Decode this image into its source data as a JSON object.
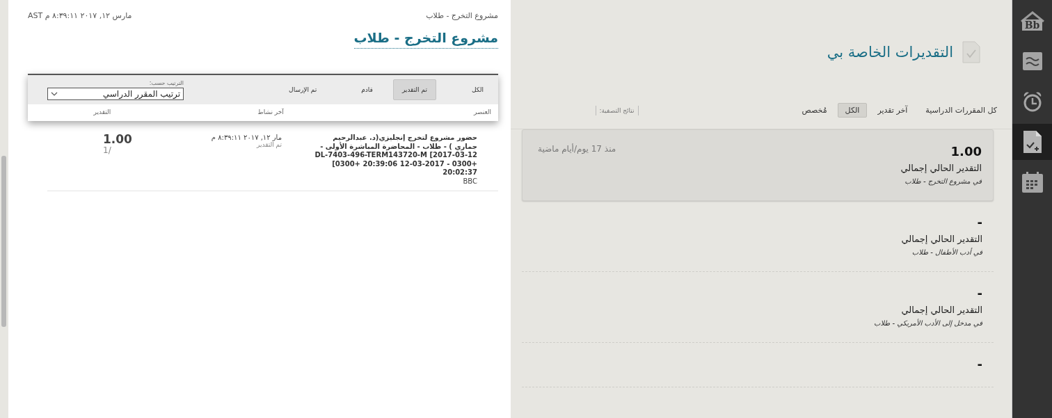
{
  "detail_panel": {
    "breadcrumb": "مشروع التخرج - طلاب",
    "timestamp": "مارس ١٢, ٢٠١٧ ٨:٣٩:١١ م AST",
    "title": "مشروع التخرج - طلاب",
    "filters": [
      {
        "label": "الكل",
        "selected": false
      },
      {
        "label": "تم التقدير",
        "selected": true
      },
      {
        "label": "قادم",
        "selected": false
      },
      {
        "label": "تم الإرسال",
        "selected": false
      }
    ],
    "sort": {
      "label": "الترتيب حسب:",
      "value": "ترتيب المقرر الدراسي"
    },
    "columns": [
      "العنصر",
      "آخر نشاط",
      "التقدير"
    ],
    "rows": [
      {
        "item": "حضور مشروع لتخرج إنجليزي(د. عبدالرحيم جماري ) - طلاب - المحاضرة المباشرة الأولى - 12-03-2017] DL-7403-496-TERM143720-M [0300+ 20:39:06 12-03-2017 - 0300+ 20:02:37",
        "source": "BBC",
        "date": "مار ١٢, ٢٠١٧ ٨:٣٩:١١ م",
        "status": "تم التقدير",
        "grade": "1.00",
        "out_of": "1/"
      }
    ]
  },
  "grades_panel": {
    "title": "التقديرات الخاصة بي",
    "filters": [
      {
        "label": "كل المقررات الدراسية",
        "selected": false
      },
      {
        "label": "آخر تقدير",
        "selected": false
      },
      {
        "label": "الكل",
        "selected": true
      },
      {
        "label": "مُخصص",
        "selected": false
      }
    ],
    "filter_results_label": "نتائج التصفية:",
    "items": [
      {
        "grade": "1.00",
        "label": "التقدير الحالي إجمالي",
        "course": "في مشروع التخرج - طلاب",
        "age": "منذ 17 يوم/أيام ماضية",
        "selected": true
      },
      {
        "grade": "-",
        "label": "التقدير الحالي إجمالي",
        "course": "في أدب الأطفال - طلاب",
        "selected": false
      },
      {
        "grade": "-",
        "label": "التقدير الحالي إجمالي",
        "course": "في مدخل إلى الأدب الأمريكي - طلاب",
        "selected": false
      },
      {
        "grade": "-",
        "selected": false
      }
    ]
  },
  "nav_rail": {
    "items": [
      {
        "kind": "logo",
        "label": "Bb",
        "selected": false
      },
      {
        "kind": "stream",
        "selected": false
      },
      {
        "kind": "alarm",
        "selected": false
      },
      {
        "kind": "grades",
        "selected": true
      },
      {
        "kind": "calendar",
        "selected": false
      }
    ]
  }
}
